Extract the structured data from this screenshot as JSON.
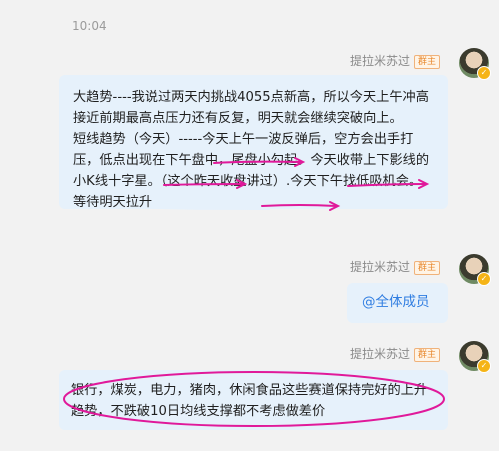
{
  "conversation": {
    "timestamp": "10:04",
    "messages": [
      {
        "sender": "提拉米苏过",
        "badge": "群主",
        "paragraphs": [
          "大趋势----我说过两天内挑战4055点新高，所以今天上午冲高接近前期最高点压力还有反复，明天就会继续突破向上。",
          "短线趋势（今天）-----今天上午一波反弹后，空方会出手打压，低点出现在下午盘中，尾盘小勾起。今天收带上下影线的小K线十字星。（这个昨天收盘讲过）.今天下午找低吸机会。等待明天拉升"
        ]
      },
      {
        "sender": "提拉米苏过",
        "badge": "群主",
        "mention": "@全体成员"
      },
      {
        "sender": "提拉米苏过",
        "badge": "群主",
        "text": "银行，煤炭，电力，猪肉，休闲食品这些赛道保持完好的上升趋势，不跌破10日均线支撑都不考虑做差价"
      }
    ]
  },
  "colors": {
    "background": "#f2f2f2",
    "bubble": "#e6f1fb",
    "mention": "#2f7de1",
    "annotation": "#e0199a",
    "badge": "#e8892f"
  }
}
